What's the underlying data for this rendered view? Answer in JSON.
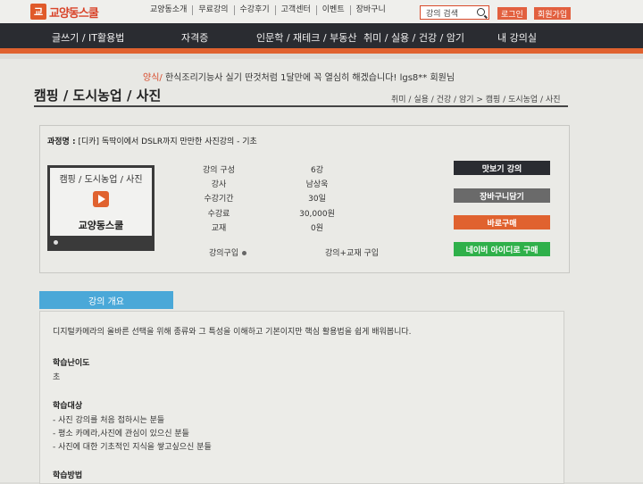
{
  "brand": {
    "logo_mark": "교",
    "name": "교양동스쿨"
  },
  "top_links": [
    "교양동소개",
    "무료강의",
    "수강후기",
    "고객센터",
    "이벤트",
    "장바구니"
  ],
  "search": {
    "placeholder": "강의 검색",
    "icon": "search-icon"
  },
  "top_buttons": {
    "login": "로그인",
    "join": "회원가입"
  },
  "nav": [
    "글쓰기 / IT활용법",
    "자격증",
    "인문학 / 재테크 / 부동산",
    "취미 / 실용 / 건강 / 암기",
    "내 강의실"
  ],
  "notice": {
    "highlight": "양식/",
    "text": "한식조리기능사 실기 딴것처럼 1달만에 꼭 열심히 해겠습니다! lgs8** 회원님"
  },
  "category": {
    "title": "캠핑 / 도시농업 / 사진",
    "breadcrumb": "취미 / 실용 / 건강 / 암기 > 캠핑 / 도시농업 / 사진"
  },
  "course": {
    "label": "과정명 :",
    "name": "[디카] 독딱이에서 DSLR까지 만만한 사진강의 - 기초",
    "thumb_category": "캠핑 / 도시농업 / 사진",
    "thumb_logo": "교양동스쿨",
    "info": [
      {
        "label": "강의 구성",
        "value": "6강"
      },
      {
        "label": "강사",
        "value": "남상욱"
      },
      {
        "label": "수강기간",
        "value": "30일"
      },
      {
        "label": "수강료",
        "value": "30,000원"
      },
      {
        "label": "교재",
        "value": "0원"
      }
    ],
    "options": {
      "lecture_only": "강의구입",
      "lecture_book": "강의+교재 구입"
    },
    "buttons": {
      "preview": "맛보기 강의",
      "cart": "장바구니담기",
      "buy": "바로구매",
      "naver": "네이버 아이디로 구매"
    }
  },
  "overview": {
    "tab": "강의 개요",
    "intro": "디지털카메라의 올바른 선택을 위해 종류와 그 특성을 이해하고 기본이지만 핵심 활용법을 쉽게 배워봅니다.",
    "difficulty_title": "학습난이도",
    "difficulty": "초",
    "target_title": "학습대상",
    "targets": [
      "- 사진 강의를 처음 접하시는 분들",
      "- 평소 카메라,사진에 관심이 있으신 분들",
      "- 사진에 대한 기초적인 지식을 쌓고싶으신 분들"
    ],
    "method_title": "학습방법"
  },
  "colors": {
    "accent": "#e0622f",
    "nav_bg": "#2a2c31",
    "preview": "#2a2c31",
    "cart": "#6a6a6a",
    "buy": "#e0622f",
    "naver": "#2fb04a",
    "tab": "#4aa8d8"
  }
}
